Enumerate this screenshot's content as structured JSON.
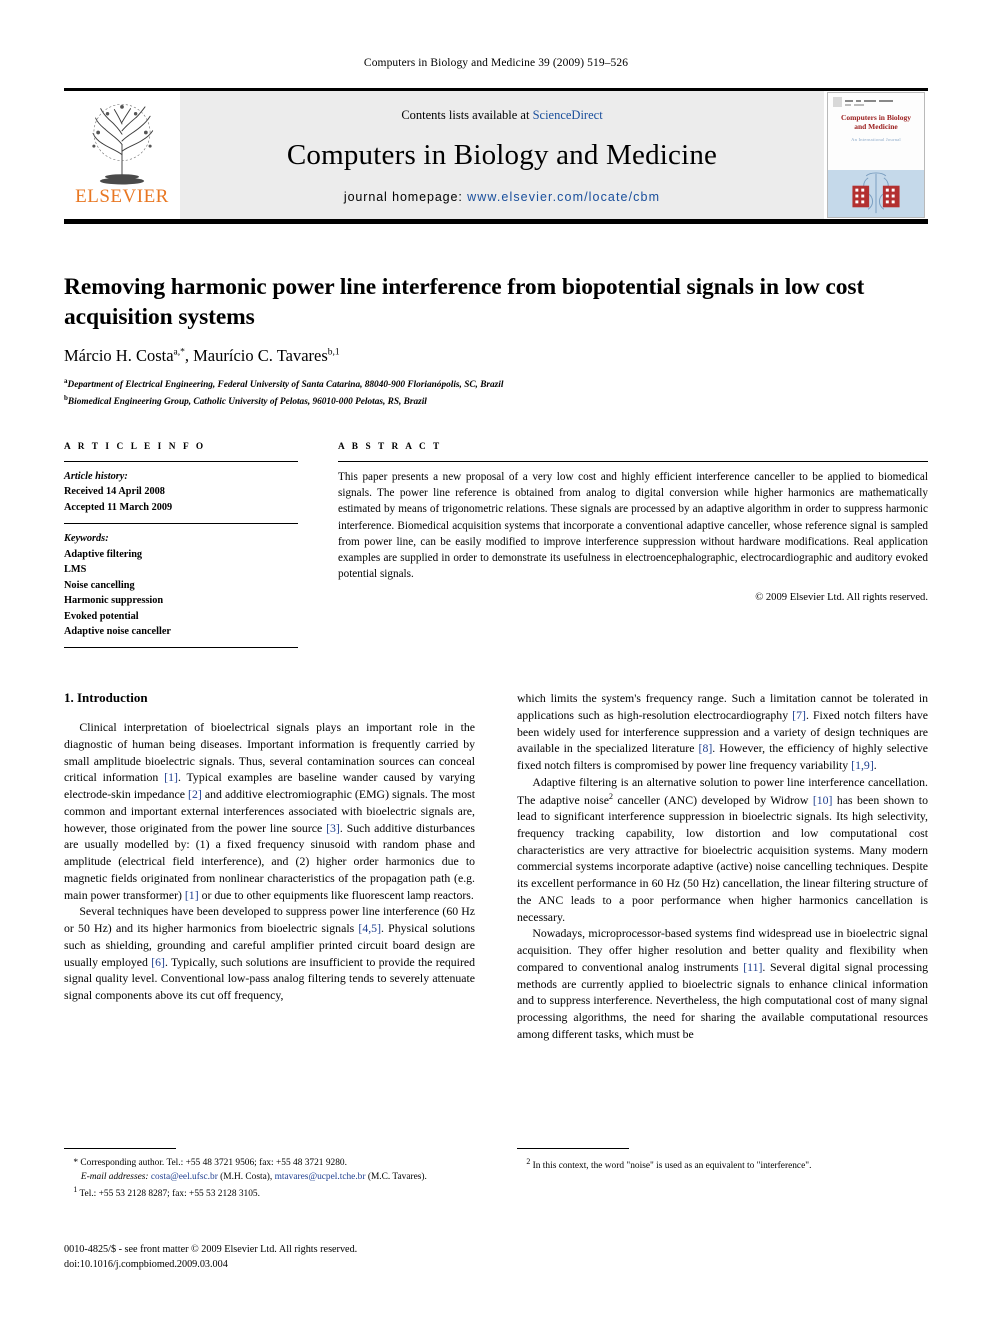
{
  "running_head": "Computers in Biology and Medicine 39 (2009) 519–526",
  "masthead": {
    "contents_prefix": "Contents lists available at ",
    "sciencedirect": "ScienceDirect",
    "journal_title": "Computers in Biology and Medicine",
    "homepage_label": "journal homepage:",
    "homepage_url": "www.elsevier.com/locate/cbm",
    "publisher": "ELSEVIER",
    "cover": {
      "title_line1": "Computers in Biology",
      "title_line2": "and Medicine",
      "subtitle": "An International Journal"
    }
  },
  "article": {
    "title": "Removing harmonic power line interference from biopotential signals in low cost acquisition systems",
    "authors": "Márcio H. Costa",
    "authors_sup_a": "a,*",
    "authors_sep": ", Maurićio C. Tavares",
    "authors_full_first": "Márcio H. Costa",
    "authors_full_second": "Maurício C. Tavares",
    "authors_sup_b": "b,1",
    "affiliation_a_sup": "a",
    "affiliation_a": "Department of Electrical Engineering, Federal University of Santa Catarina, 88040-900 Florianópolis, SC, Brazil",
    "affiliation_b_sup": "b",
    "affiliation_b": "Biomedical Engineering Group, Catholic University of Pelotas, 96010-000 Pelotas, RS, Brazil"
  },
  "article_info": {
    "heading": "A R T I C L E   I N F O",
    "history_label": "Article history:",
    "received": "Received 14 April 2008",
    "accepted": "Accepted 11 March 2009",
    "keywords_label": "Keywords:",
    "keywords": [
      "Adaptive filtering",
      "LMS",
      "Noise cancelling",
      "Harmonic suppression",
      "Evoked potential",
      "Adaptive noise canceller"
    ]
  },
  "abstract": {
    "heading": "A B S T R A C T",
    "text": "This paper presents a new proposal of a very low cost and highly efficient interference canceller to be applied to biomedical signals. The power line reference is obtained from analog to digital conversion while higher harmonics are mathematically estimated by means of trigonometric relations. These signals are processed by an adaptive algorithm in order to suppress harmonic interference. Biomedical acquisition systems that incorporate a conventional adaptive canceller, whose reference signal is sampled from power line, can be easily modified to improve interference suppression without hardware modifications. Real application examples are supplied in order to demonstrate its usefulness in electroencephalographic, electrocardiographic and auditory evoked potential signals.",
    "copyright": "© 2009 Elsevier Ltd. All rights reserved."
  },
  "body": {
    "section_title": "1. Introduction",
    "left_paragraphs": [
      {
        "parts": [
          {
            "t": "Clinical interpretation of bioelectrical signals plays an important role in the diagnostic of human being diseases. Important information is frequently carried by small amplitude bioelectric signals. Thus, several contamination sources can conceal critical information "
          },
          {
            "t": "[1]",
            "ref": true
          },
          {
            "t": ". Typical examples are baseline wander caused by varying electrode-skin impedance "
          },
          {
            "t": "[2]",
            "ref": true
          },
          {
            "t": " and additive electromiographic (EMG) signals. The most common and important external interferences associated with bioelectric signals are, however, those originated from the power line source "
          },
          {
            "t": "[3]",
            "ref": true
          },
          {
            "t": ". Such additive disturbances are usually modelled by: (1) a fixed frequency sinusoid with random phase and amplitude (electrical field interference), and (2) higher order harmonics due to magnetic fields originated from nonlinear characteristics of the propagation path (e.g. main power transformer) "
          },
          {
            "t": "[1]",
            "ref": true
          },
          {
            "t": " or due to other equipments like fluorescent lamp reactors."
          }
        ]
      },
      {
        "parts": [
          {
            "t": "Several techniques have been developed to suppress power line interference (60 Hz or 50 Hz) and its higher harmonics from bioelectric signals "
          },
          {
            "t": "[4,5]",
            "ref": true
          },
          {
            "t": ". Physical solutions such as shielding, grounding and careful amplifier printed circuit board design are usually employed "
          },
          {
            "t": "[6]",
            "ref": true
          },
          {
            "t": ". Typically, such solutions are insufficient to provide the required signal quality level. Conventional low-pass analog filtering tends to severely attenuate signal components above its cut off frequency,"
          }
        ]
      }
    ],
    "right_paragraphs": [
      {
        "no_indent": true,
        "parts": [
          {
            "t": "which limits the system's frequency range. Such a limitation cannot be tolerated in applications such as high-resolution electrocardiography "
          },
          {
            "t": "[7]",
            "ref": true
          },
          {
            "t": ". Fixed notch filters have been widely used for interference suppression and a variety of design techniques are available in the specialized literature "
          },
          {
            "t": "[8]",
            "ref": true
          },
          {
            "t": ". However, the efficiency of highly selective fixed notch filters is compromised by power line frequency variability "
          },
          {
            "t": "[1,9]",
            "ref": true
          },
          {
            "t": "."
          }
        ]
      },
      {
        "parts": [
          {
            "t": "Adaptive filtering is an alternative solution to power line interference cancellation. The adaptive noise"
          },
          {
            "t": "2",
            "sup": true
          },
          {
            "t": " canceller (ANC) developed by Widrow "
          },
          {
            "t": "[10]",
            "ref": true
          },
          {
            "t": " has been shown to lead to significant interference suppression in bioelectric signals. Its high selectivity, frequency tracking capability, low distortion and low computational cost characteristics are very attractive for bioelectric acquisition systems. Many modern commercial systems incorporate adaptive (active) noise cancelling techniques. Despite its excellent performance in 60 Hz (50 Hz) cancellation, the linear filtering structure of the ANC leads to a poor performance when higher harmonics cancellation is necessary."
          }
        ]
      },
      {
        "parts": [
          {
            "t": "Nowadays, microprocessor-based systems find widespread use in bioelectric signal acquisition. They offer higher resolution and better quality and flexibility when compared to conventional analog instruments "
          },
          {
            "t": "[11]",
            "ref": true
          },
          {
            "t": ". Several digital signal processing methods are currently applied to bioelectric signals to enhance clinical information and to suppress interference. Nevertheless, the high computational cost of many signal processing algorithms, the need for sharing the available computational resources among different tasks, which must be"
          }
        ]
      }
    ]
  },
  "footnotes": {
    "corresponding": "* Corresponding author. Tel.: +55 48 3721 9506; fax: +55 48 3721 9280.",
    "email_label": "E-mail addresses:",
    "email1": "costa@eel.ufsc.br",
    "email1_owner": " (M.H. Costa), ",
    "email2": "mtavares@ucpel.tche.br",
    "email2_owner": "(M.C. Tavares).",
    "fn1_sup": "1",
    "fn1": " Tel.: +55 53 2128 8287; fax: +55 53 2128 3105.",
    "fn2_sup": "2",
    "fn2": " In this context, the word \"noise\" is used as an equivalent to \"interference\"."
  },
  "imprint": {
    "line1": "0010-4825/$ - see front matter © 2009 Elsevier Ltd. All rights reserved.",
    "line2": "doi:10.1016/j.compbiomed.2009.03.004"
  },
  "colors": {
    "link": "#1f3f8f",
    "elsevier_orange": "#E87722",
    "band_gray": "#ececec",
    "cover_blue": "#c5d9ea",
    "cover_red": "#9a1d1d"
  }
}
